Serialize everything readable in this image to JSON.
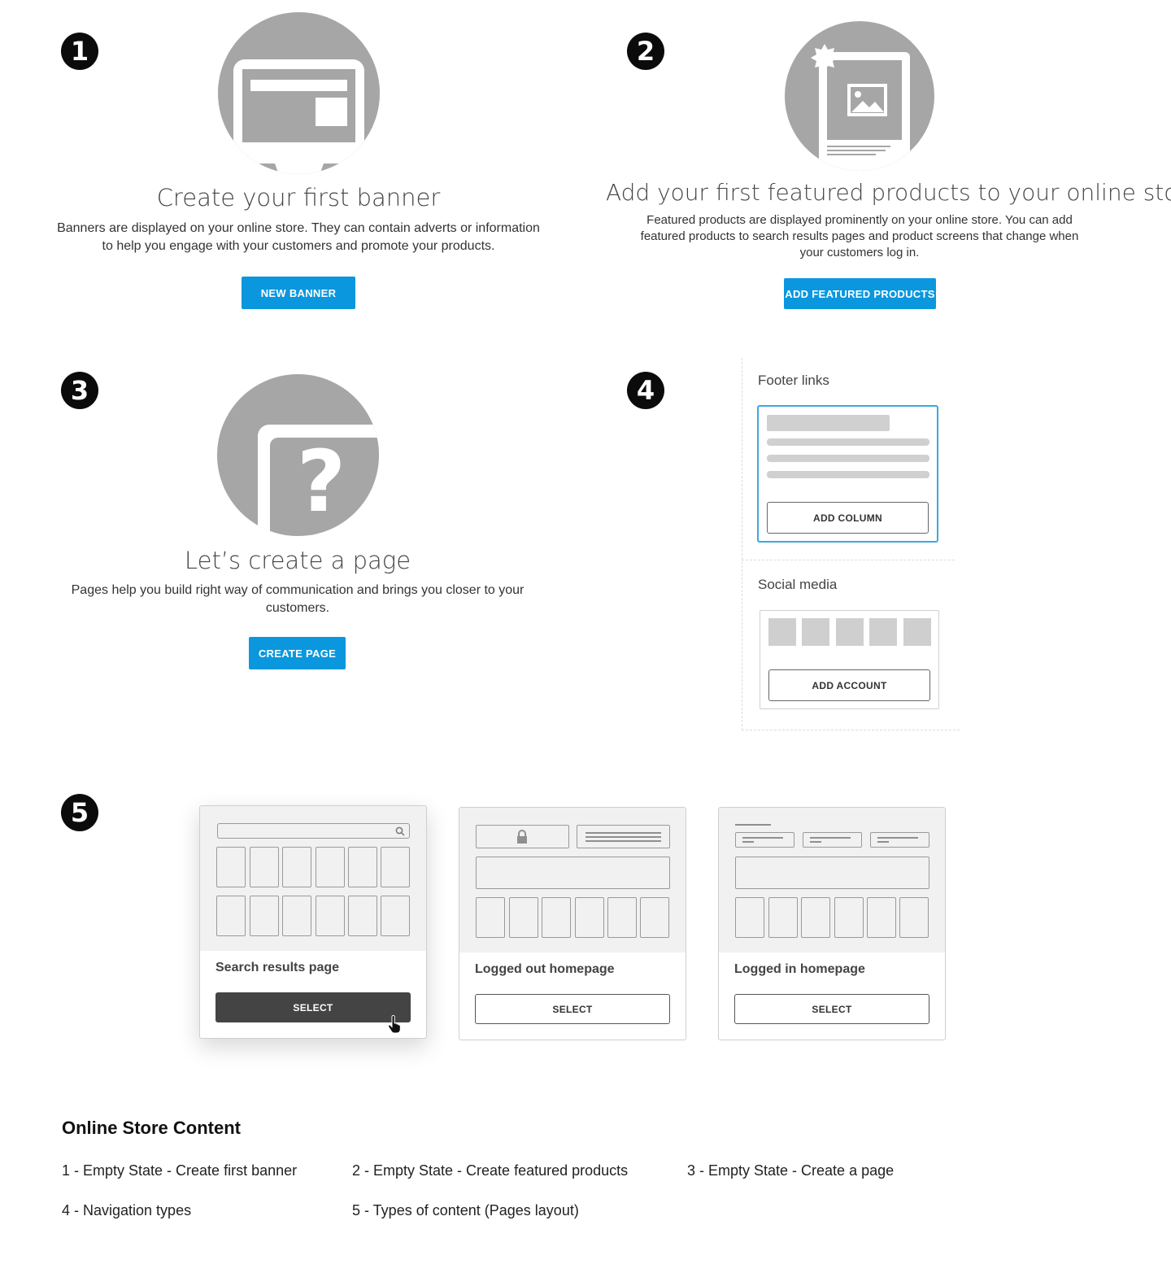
{
  "sections": {
    "banner": {
      "number": "1",
      "title": "Create your first banner",
      "description": "Banners are displayed on your online store. They can contain adverts or information to help you engage with your customers and promote your products.",
      "button": "NEW BANNER",
      "icon": "monitor-banner-icon"
    },
    "featured": {
      "number": "2",
      "title": "Add your first featured products to your online store",
      "description": "Featured products are displayed prominently on your online store. You can add featured products to search results pages and product screens that change when your customers log in.",
      "button": "ADD FEATURED PRODUCTS",
      "icon": "featured-product-icon"
    },
    "page": {
      "number": "3",
      "title": "Let’s create a page",
      "description": "Pages help you build right way of communication and brings you closer to your customers.",
      "button": "CREATE PAGE",
      "icon": "question-page-icon"
    },
    "navigation": {
      "number": "4",
      "footer_links": {
        "label": "Footer links",
        "button": "ADD COLUMN"
      },
      "social_media": {
        "label": "Social media",
        "button": "ADD ACCOUNT"
      }
    },
    "layouts": {
      "number": "5",
      "cards": [
        {
          "title": "Search results page",
          "button": "SELECT"
        },
        {
          "title": "Logged out homepage",
          "button": "SELECT"
        },
        {
          "title": "Logged in homepage",
          "button": "SELECT"
        }
      ]
    }
  },
  "footer": {
    "title": "Online Store Content",
    "items": [
      "1 - Empty State - Create first banner",
      "2 - Empty State - Create featured products",
      "3 - Empty State - Create a page",
      "4 - Navigation types",
      "5 - Types of content (Pages layout)"
    ]
  },
  "colors": {
    "accent_blue": "#0a97de",
    "icon_gray": "#a6a6a6",
    "dark_button": "#444444",
    "selected_border": "#3aa9e0"
  }
}
